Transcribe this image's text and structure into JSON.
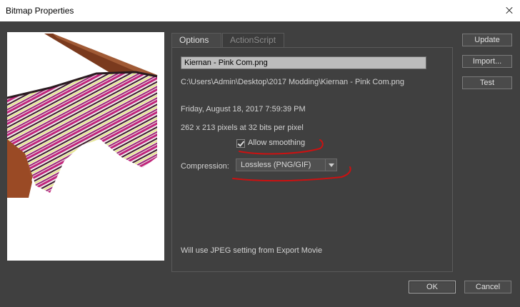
{
  "window": {
    "title": "Bitmap Properties",
    "close_icon": "close-icon"
  },
  "tabs": [
    {
      "label": "Options",
      "active": true
    },
    {
      "label": "ActionScript",
      "active": false
    }
  ],
  "options": {
    "name_value": "Kiernan - Pink Com.png",
    "path": "C:\\Users\\Admin\\Desktop\\2017 Modding\\Kiernan - Pink Com.png",
    "date": "Friday, August 18, 2017  7:59:39 PM",
    "dimensions": "262 x 213 pixels at 32 bits per pixel",
    "allow_smoothing_label": "Allow smoothing",
    "allow_smoothing_checked": true,
    "compression_label": "Compression:",
    "compression_value": "Lossless (PNG/GIF)",
    "footer_note": "Will use JPEG setting from Export Movie"
  },
  "side_buttons": {
    "update": "Update",
    "import": "Import...",
    "test": "Test"
  },
  "bottom_buttons": {
    "ok": "OK",
    "cancel": "Cancel"
  },
  "colors": {
    "background": "#404040",
    "annotation": "#cc1111",
    "shoe_body": "#a0522d"
  }
}
